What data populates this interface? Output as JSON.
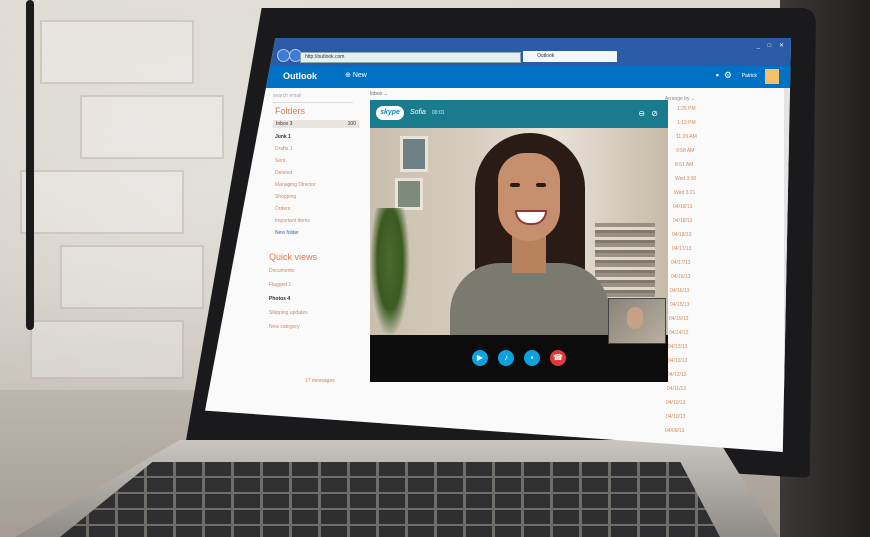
{
  "browser": {
    "url": "http://outlook.com",
    "tab_title": "Outlook",
    "window_controls": "_ □ ✕"
  },
  "owa": {
    "app_name": "Outlook",
    "new_label": "New",
    "user_name": "Patrick",
    "search_placeholder": "search email"
  },
  "folders": {
    "heading": "Folders",
    "items": [
      {
        "label": "Inbox 3",
        "count": "100"
      },
      {
        "label": "Junk 1"
      },
      {
        "label": "Drafts 1"
      },
      {
        "label": "Sent"
      },
      {
        "label": "Deleted"
      },
      {
        "label": "Managing Director"
      },
      {
        "label": "Shopping"
      },
      {
        "label": "Orders"
      },
      {
        "label": "Important Items"
      },
      {
        "label": "New folder"
      }
    ]
  },
  "quick_views": {
    "heading": "Quick views",
    "items": [
      {
        "label": "Documents"
      },
      {
        "label": "Flagged 1"
      },
      {
        "label": "Photos 4"
      },
      {
        "label": "Shipping updates"
      },
      {
        "label": "New category"
      }
    ]
  },
  "message_list": {
    "view_label": "Inbox ⌄",
    "arrange_label": "Arrange by ⌄",
    "times": [
      "1:25 PM",
      "1:13 PM",
      "11:29 AM",
      "9:58 AM",
      "8:51 AM",
      "Wed 3:30",
      "Wed 3:21",
      "04/19/13",
      "04/18/13",
      "04/18/13",
      "04/17/13",
      "04/17/13",
      "04/16/13",
      "04/16/13",
      "04/15/13",
      "04/15/13",
      "04/14/13",
      "04/13/13",
      "04/12/13",
      "04/12/13",
      "04/11/13",
      "04/10/13",
      "04/10/13",
      "04/09/13"
    ]
  },
  "skype": {
    "logo_text": "skype",
    "contact_name": "Sofia",
    "call_time": "00:01",
    "controls": "⊖ ⊘"
  },
  "footer": {
    "messages_label": "17 messages"
  },
  "colors": {
    "outlook_blue": "#0072c6",
    "skype_bar": "#1a7a8e",
    "folder_accent": "#e07a45",
    "end_call": "#e23a3a",
    "call_button": "#0aa3e0"
  }
}
